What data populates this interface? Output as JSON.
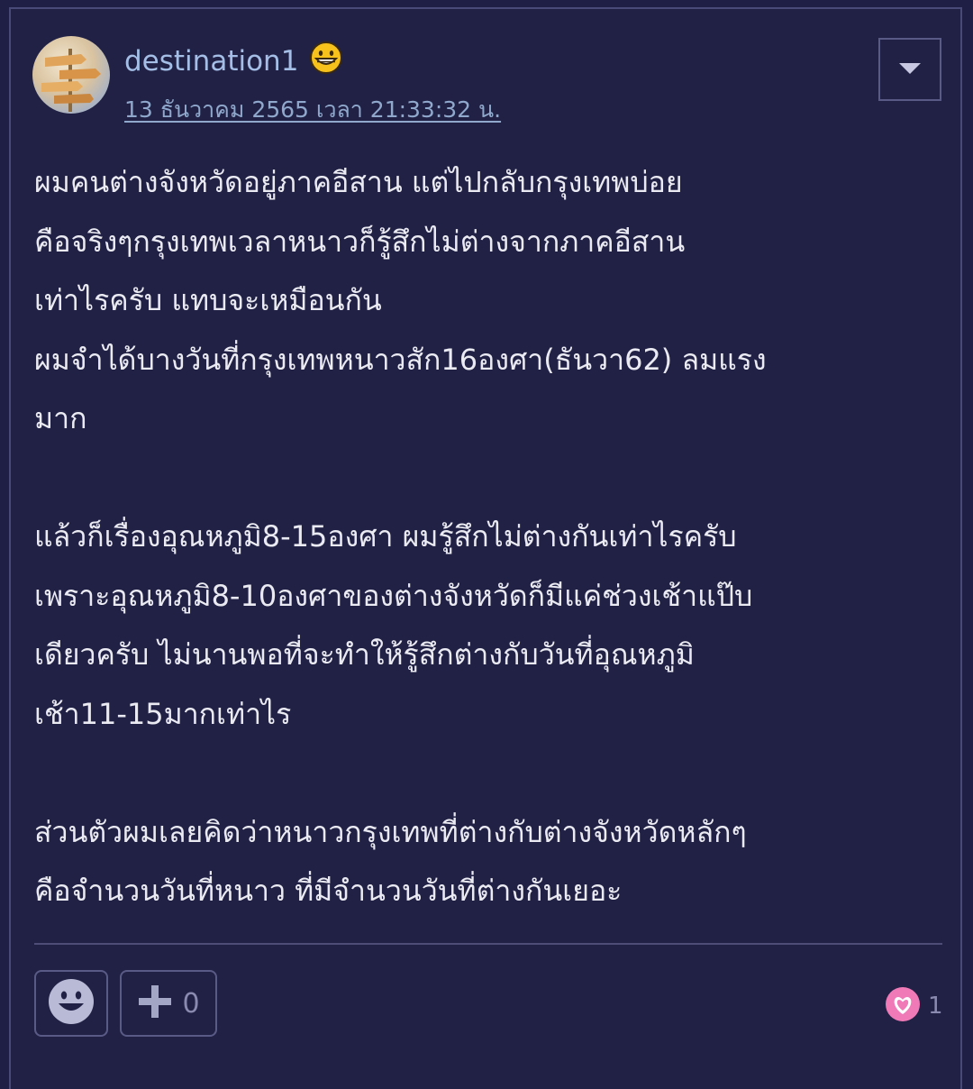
{
  "comment": {
    "author": {
      "username": "destination1",
      "badge_icon": "grinning-face-icon"
    },
    "timestamp": "13 ธันวาคม 2565 เวลา 21:33:32 น.",
    "menu_icon": "chevron-down-icon",
    "paragraphs": [
      {
        "lines": [
          "ผมคนต่างจังหวัดอยู่ภาคอีสาน  แต่ไปกลับกรุงเทพบ่อย",
          "คือจริงๆกรุงเทพเวลาหนาวก็รู้สึกไม่ต่างจากภาคอีสาน",
          "เท่าไรครับ แทบจะเหมือนกัน",
          "ผมจำได้บางวันที่กรุงเทพหนาวสัก16องศา(ธันวา62) ลมแรง",
          "มาก"
        ]
      },
      {
        "lines": [
          "แล้วก็เรื่องอุณหภูมิ8-15องศา ผมรู้สึกไม่ต่างกันเท่าไรครับ",
          "เพราะอุณหภูมิ8-10องศาของต่างจังหวัดก็มีแค่ช่วงเช้าแป๊บ",
          "เดียวครับ ไม่นานพอที่จะทำให้รู้สึกต่างกับวันที่อุณหภูมิ",
          "เช้า11-15มากเท่าไร"
        ]
      },
      {
        "lines": [
          "ส่วนตัวผมเลยคิดว่าหนาวกรุงเทพที่ต่างกับต่างจังหวัดหลักๆ",
          "คือจำนวนวันที่หนาว ที่มีจำนวนวันที่ต่างกันเยอะ"
        ]
      }
    ],
    "footer": {
      "emotion_icon": "smiley-face-icon",
      "vote_icon": "plus-icon",
      "vote_count": "0",
      "reaction_icon": "heart-icon",
      "reaction_count": "1"
    }
  },
  "colors": {
    "background": "#212145",
    "username": "#a4bee6",
    "body_text": "#eaeaf2",
    "heart": "#f07ab8"
  }
}
